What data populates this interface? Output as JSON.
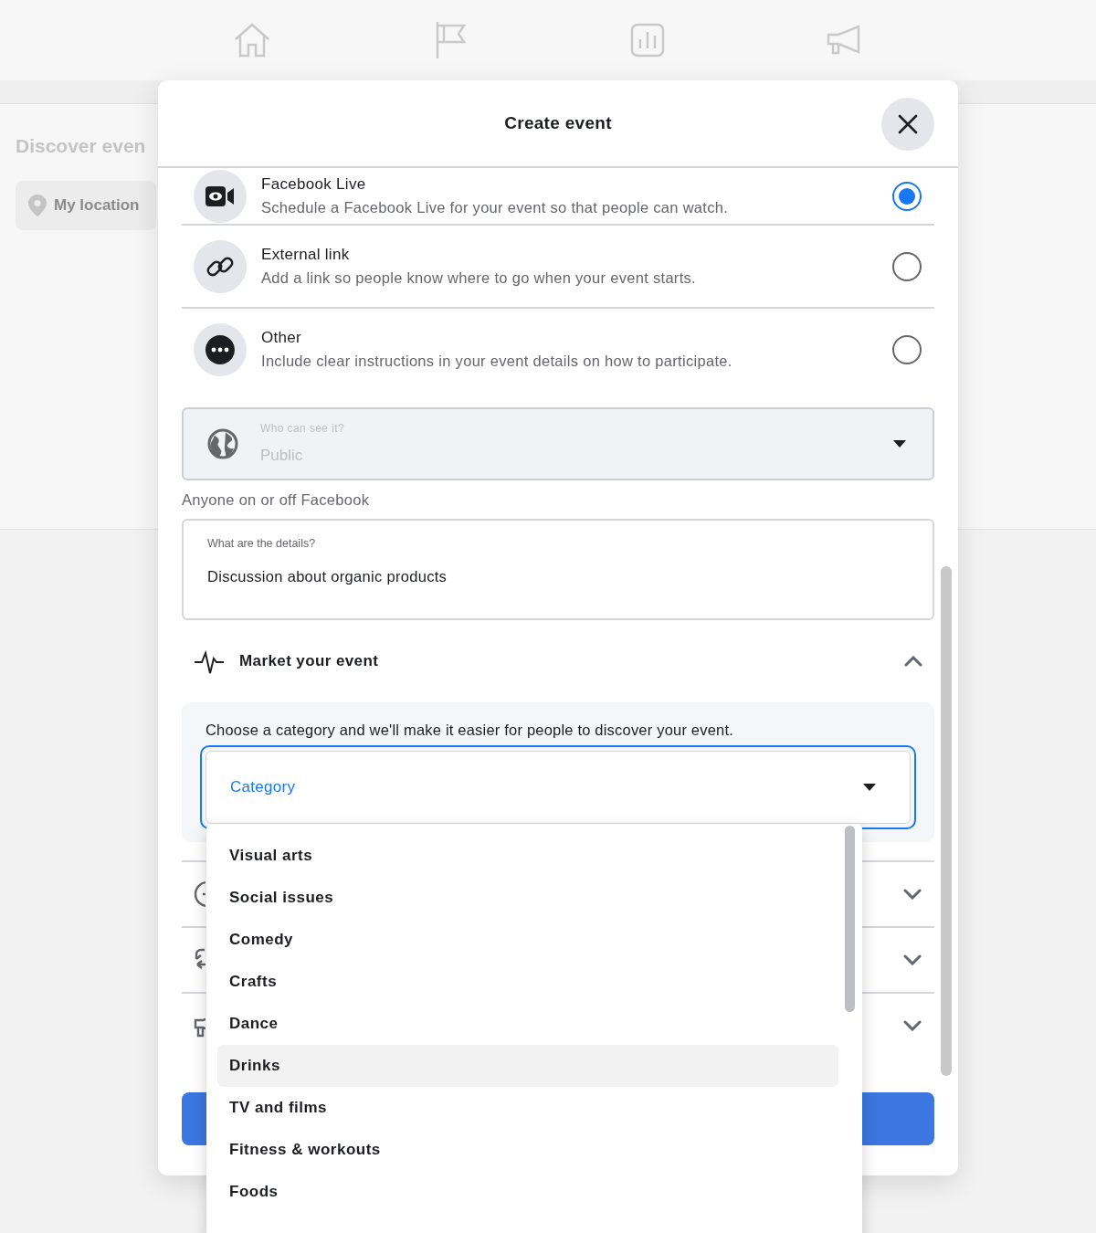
{
  "background": {
    "heading": "Discover even",
    "location_placeholder": "My location"
  },
  "modal": {
    "title": "Create event",
    "location_options": [
      {
        "title": "Facebook Live",
        "description": "Schedule a Facebook Live for your event so that people can watch.",
        "selected": true
      },
      {
        "title": "External link",
        "description": "Add a link so people know where to go when your event starts.",
        "selected": false
      },
      {
        "title": "Other",
        "description": "Include clear instructions in your event details on how to participate.",
        "selected": false
      }
    ],
    "privacy": {
      "label": "Who can see it?",
      "value": "Public",
      "disabled": true
    },
    "privacy_help": "Anyone on or off Facebook",
    "details": {
      "label": "What are the details?",
      "value": "Discussion about organic products"
    },
    "market": {
      "title": "Market your event",
      "expanded": true,
      "prompt": "Choose a category and we'll make it easier for people to discover your event.",
      "category_placeholder": "Category"
    },
    "collapsed_sections": [
      {
        "expanded": false
      },
      {
        "expanded": false
      },
      {
        "expanded": false
      }
    ],
    "category_menu": [
      {
        "label": "Visual arts",
        "selected": false
      },
      {
        "label": "Social issues",
        "selected": false
      },
      {
        "label": "Comedy",
        "selected": false
      },
      {
        "label": "Crafts",
        "selected": false
      },
      {
        "label": "Dance",
        "selected": false
      },
      {
        "label": "Drinks",
        "selected": true
      },
      {
        "label": "TV and films",
        "selected": false
      },
      {
        "label": "Fitness & workouts",
        "selected": false
      },
      {
        "label": "Foods",
        "selected": false
      }
    ]
  }
}
